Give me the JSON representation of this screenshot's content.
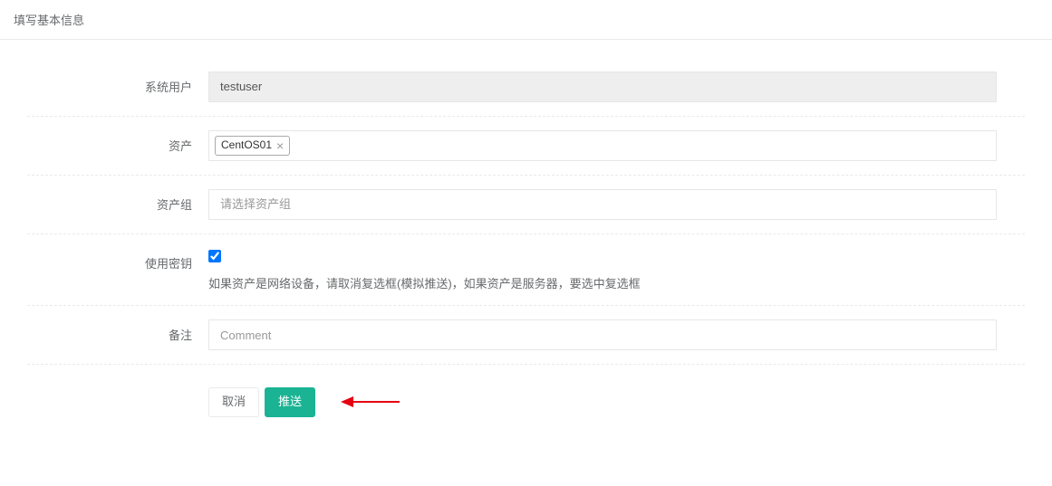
{
  "heading": "填写基本信息",
  "fields": {
    "systemUser": {
      "label": "系统用户",
      "value": "testuser"
    },
    "asset": {
      "label": "资产",
      "tag": "CentOS01"
    },
    "assetGroup": {
      "label": "资产组",
      "placeholder": "请选择资产组"
    },
    "useKey": {
      "label": "使用密钥",
      "help": "如果资产是网络设备，请取消复选框(模拟推送)，如果资产是服务器，要选中复选框"
    },
    "comment": {
      "label": "备注",
      "placeholder": "Comment"
    }
  },
  "actions": {
    "cancel": "取消",
    "submit": "推送"
  }
}
